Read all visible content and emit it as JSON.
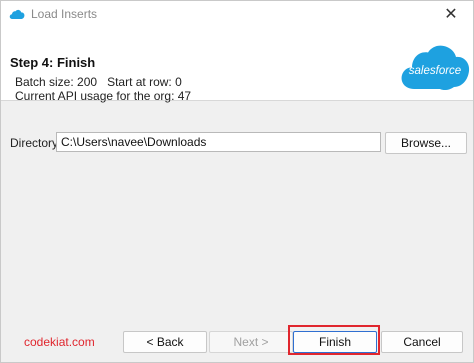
{
  "window": {
    "title": "Load Inserts",
    "close_glyph": "✕"
  },
  "header": {
    "step_title": "Step 4: Finish",
    "batch_size": "Batch size: 200",
    "start_row": "Start at row: 0",
    "api_usage": "Current API usage for the org: 47",
    "logo_text": "salesforce"
  },
  "directory": {
    "label": "Directory:",
    "value": "C:\\Users\\navee\\Downloads",
    "browse_label": "Browse..."
  },
  "buttons": {
    "back": "< Back",
    "next": "Next >",
    "finish": "Finish",
    "cancel": "Cancel"
  },
  "watermark": "codekiat.com",
  "colors": {
    "brand": "#1ea1e0",
    "highlight": "#e0262e"
  },
  "icons": {
    "app": "salesforce-cloud-icon",
    "close": "close-icon"
  }
}
